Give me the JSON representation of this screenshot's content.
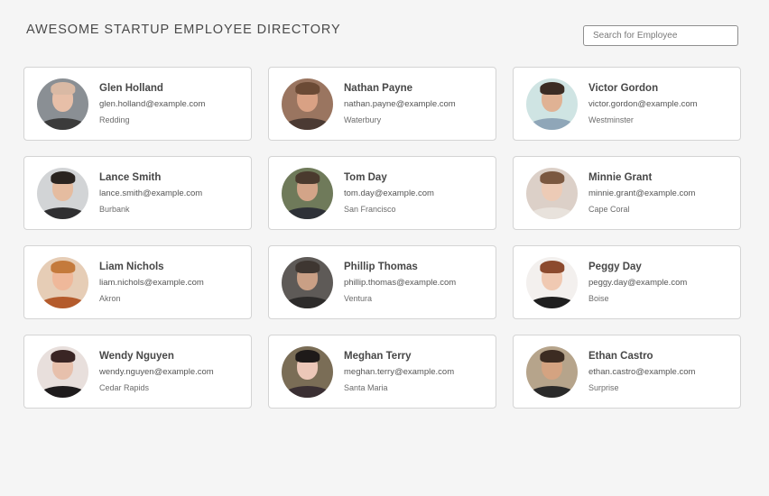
{
  "header": {
    "title": "AWESOME STARTUP EMPLOYEE DIRECTORY",
    "search_placeholder": "Search for Employee"
  },
  "employees": [
    {
      "name": "Glen Holland",
      "email": "glen.holland@example.com",
      "city": "Redding",
      "avatar": {
        "bg": "#8a8f94",
        "skin": "#e7bfa8",
        "hair": "#d9b9a4",
        "top": "#3b3b3b"
      }
    },
    {
      "name": "Nathan Payne",
      "email": "nathan.payne@example.com",
      "city": "Waterbury",
      "avatar": {
        "bg": "#9a7560",
        "skin": "#d9a184",
        "hair": "#6b4a35",
        "top": "#4b3a33"
      }
    },
    {
      "name": "Victor Gordon",
      "email": "victor.gordon@example.com",
      "city": "Westminster",
      "avatar": {
        "bg": "#cfe4e3",
        "skin": "#e0b294",
        "hair": "#3b2c24",
        "top": "#8fa6b8"
      }
    },
    {
      "name": "Lance Smith",
      "email": "lance.smith@example.com",
      "city": "Burbank",
      "avatar": {
        "bg": "#d2d4d6",
        "skin": "#e5bca0",
        "hair": "#2a2420",
        "top": "#2f2f31"
      }
    },
    {
      "name": "Tom Day",
      "email": "tom.day@example.com",
      "city": "San Francisco",
      "avatar": {
        "bg": "#6f7a5a",
        "skin": "#d3a488",
        "hair": "#4a3a2e",
        "top": "#2e3137"
      }
    },
    {
      "name": "Minnie Grant",
      "email": "minnie.grant@example.com",
      "city": "Cape Coral",
      "avatar": {
        "bg": "#dcd0c8",
        "skin": "#edcbb6",
        "hair": "#7b5840",
        "top": "#e8e2dc"
      }
    },
    {
      "name": "Liam Nichols",
      "email": "liam.nichols@example.com",
      "city": "Akron",
      "avatar": {
        "bg": "#e6cdb6",
        "skin": "#efb89a",
        "hair": "#c47a3c",
        "top": "#b45b2c"
      }
    },
    {
      "name": "Phillip Thomas",
      "email": "phillip.thomas@example.com",
      "city": "Ventura",
      "avatar": {
        "bg": "#5e5a57",
        "skin": "#c99f85",
        "hair": "#3e3631",
        "top": "#2d2b2a"
      }
    },
    {
      "name": "Peggy Day",
      "email": "peggy.day@example.com",
      "city": "Boise",
      "avatar": {
        "bg": "#f3f0ee",
        "skin": "#f0c9b2",
        "hair": "#8c4a2e",
        "top": "#1f1f1f"
      }
    },
    {
      "name": "Wendy Nguyen",
      "email": "wendy.nguyen@example.com",
      "city": "Cedar Rapids",
      "avatar": {
        "bg": "#e8dfdc",
        "skin": "#e7c0ac",
        "hair": "#3a2524",
        "top": "#1e1b1c"
      }
    },
    {
      "name": "Meghan Terry",
      "email": "meghan.terry@example.com",
      "city": "Santa Maria",
      "avatar": {
        "bg": "#7a6d56",
        "skin": "#ecc7b8",
        "hair": "#1e1a19",
        "top": "#3a2f33"
      }
    },
    {
      "name": "Ethan Castro",
      "email": "ethan.castro@example.com",
      "city": "Surprise",
      "avatar": {
        "bg": "#b6a48b",
        "skin": "#d4a381",
        "hair": "#3c2c22",
        "top": "#2a2a2a"
      }
    }
  ]
}
